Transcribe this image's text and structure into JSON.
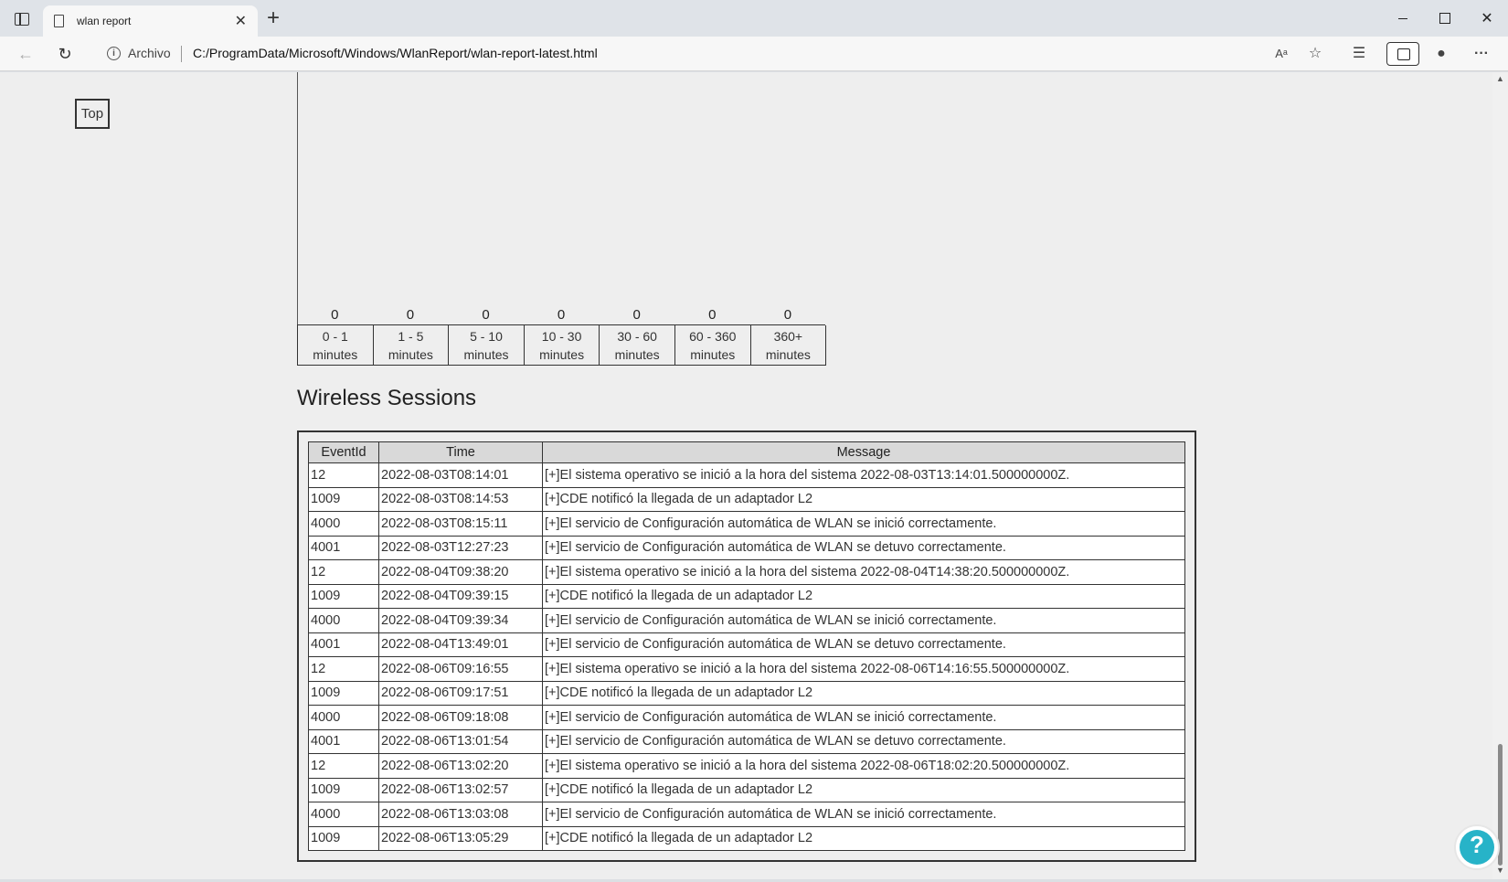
{
  "browser": {
    "tab_title": "wlan report",
    "address_label": "Archivo",
    "url": "C:/ProgramData/Microsoft/Windows/WlanReport/wlan-report-latest.html",
    "read_aloud_icon": "Aᵃ"
  },
  "page": {
    "top_button": "Top",
    "duration_buckets": [
      {
        "value": "0",
        "range": "0 - 1",
        "unit": "minutes"
      },
      {
        "value": "0",
        "range": "1 - 5",
        "unit": "minutes"
      },
      {
        "value": "0",
        "range": "5 - 10",
        "unit": "minutes"
      },
      {
        "value": "0",
        "range": "10 - 30",
        "unit": "minutes"
      },
      {
        "value": "0",
        "range": "30 - 60",
        "unit": "minutes"
      },
      {
        "value": "0",
        "range": "60 - 360",
        "unit": "minutes"
      },
      {
        "value": "0",
        "range": "360+",
        "unit": "minutes"
      }
    ],
    "sessions_title": "Wireless Sessions",
    "sessions_headers": [
      "EventId",
      "Time",
      "Message"
    ],
    "sessions_rows": [
      [
        "12",
        "2022-08-03T08:14:01",
        "[+]El sistema operativo se inició a la hora del sistema 2022-08-03T13:14:01.500000000Z."
      ],
      [
        "1009",
        "2022-08-03T08:14:53",
        "[+]CDE notificó la llegada de un adaptador L2"
      ],
      [
        "4000",
        "2022-08-03T08:15:11",
        "[+]El servicio de Configuración automática de WLAN se inició correctamente."
      ],
      [
        "4001",
        "2022-08-03T12:27:23",
        "[+]El servicio de Configuración automática de WLAN se detuvo correctamente."
      ],
      [
        "12",
        "2022-08-04T09:38:20",
        "[+]El sistema operativo se inició a la hora del sistema 2022-08-04T14:38:20.500000000Z."
      ],
      [
        "1009",
        "2022-08-04T09:39:15",
        "[+]CDE notificó la llegada de un adaptador L2"
      ],
      [
        "4000",
        "2022-08-04T09:39:34",
        "[+]El servicio de Configuración automática de WLAN se inició correctamente."
      ],
      [
        "4001",
        "2022-08-04T13:49:01",
        "[+]El servicio de Configuración automática de WLAN se detuvo correctamente."
      ],
      [
        "12",
        "2022-08-06T09:16:55",
        "[+]El sistema operativo se inició a la hora del sistema 2022-08-06T14:16:55.500000000Z."
      ],
      [
        "1009",
        "2022-08-06T09:17:51",
        "[+]CDE notificó la llegada de un adaptador L2"
      ],
      [
        "4000",
        "2022-08-06T09:18:08",
        "[+]El servicio de Configuración automática de WLAN se inició correctamente."
      ],
      [
        "4001",
        "2022-08-06T13:01:54",
        "[+]El servicio de Configuración automática de WLAN se detuvo correctamente."
      ],
      [
        "12",
        "2022-08-06T13:02:20",
        "[+]El sistema operativo se inició a la hora del sistema 2022-08-06T18:02:20.500000000Z."
      ],
      [
        "1009",
        "2022-08-06T13:02:57",
        "[+]CDE notificó la llegada de un adaptador L2"
      ],
      [
        "4000",
        "2022-08-06T13:03:08",
        "[+]El servicio de Configuración automática de WLAN se inició correctamente."
      ],
      [
        "1009",
        "2022-08-06T13:05:29",
        "[+]CDE notificó la llegada de un adaptador L2"
      ]
    ]
  },
  "colors": {
    "page_background": "#eeeeee",
    "header_background": "#d9d9d9",
    "help_badge": "#27b3c8"
  }
}
